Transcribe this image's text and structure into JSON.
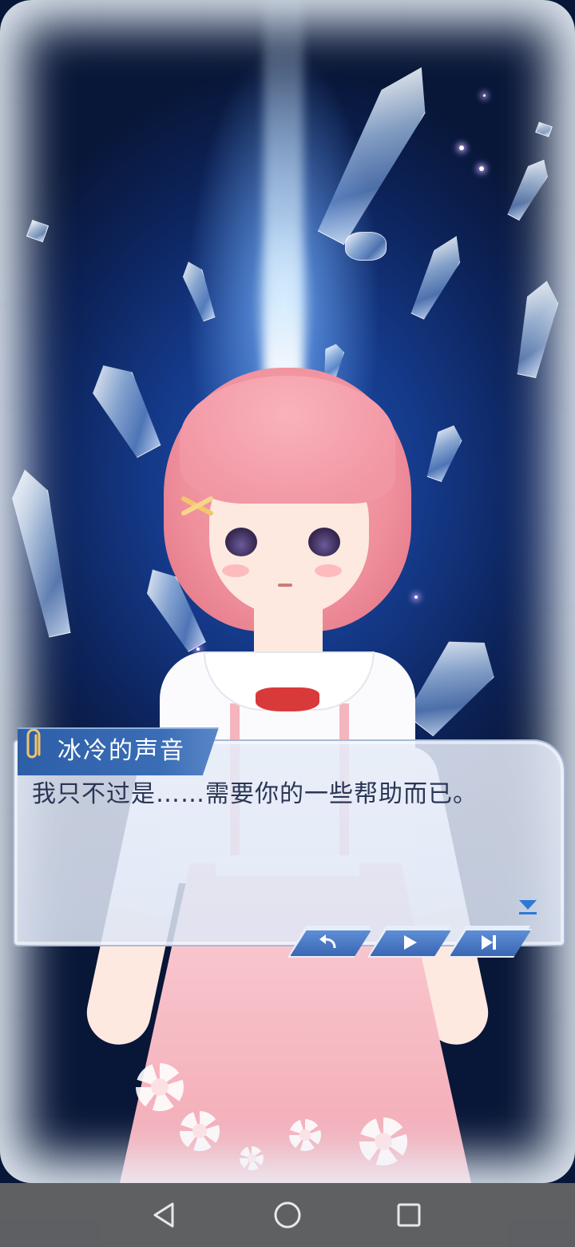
{
  "scene": {
    "background_colors": {
      "deep": "#0c2258",
      "mid": "#1d4fae",
      "beam": "#dff0ff"
    }
  },
  "dialogue": {
    "speaker": "冰冷的声音",
    "line": "我只不过是……需要你的一些帮助而已。",
    "icons": {
      "speaker_tag": "paperclip-icon",
      "advance": "advance-arrow-icon"
    }
  },
  "controls": [
    {
      "name": "back",
      "icon": "back-arrow-icon"
    },
    {
      "name": "auto",
      "icon": "play-icon"
    },
    {
      "name": "skip",
      "icon": "skip-icon"
    }
  ],
  "navbar": {
    "back": "nav-back-icon",
    "home": "nav-home-icon",
    "recents": "nav-recents-icon"
  }
}
